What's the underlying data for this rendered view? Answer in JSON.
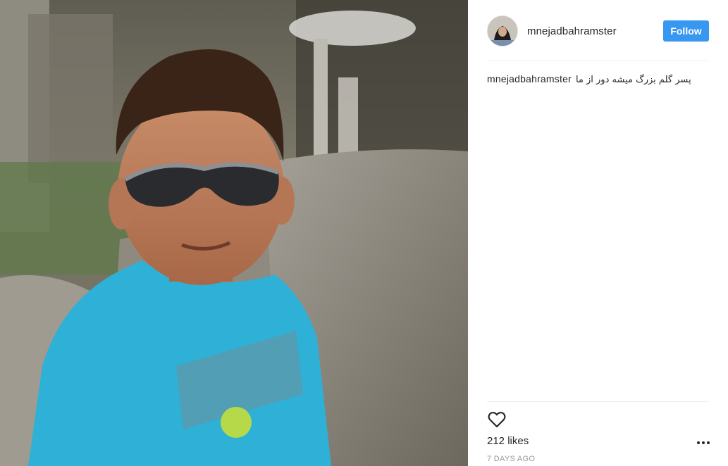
{
  "post": {
    "username": "mnejadbahramster",
    "follow_label": "Follow",
    "caption_user": "mnejadbahramster",
    "caption_text": "پسر گلم بزرگ میشه دور از ما",
    "likes": "212 likes",
    "posted_ago": "7 DAYS AGO"
  },
  "icons": {
    "like": "heart-outline-icon",
    "more": "more-options-icon"
  },
  "colors": {
    "follow_button": "#3897f0",
    "text": "#262626",
    "muted": "#999999",
    "shirt": "#2fb0d6"
  }
}
